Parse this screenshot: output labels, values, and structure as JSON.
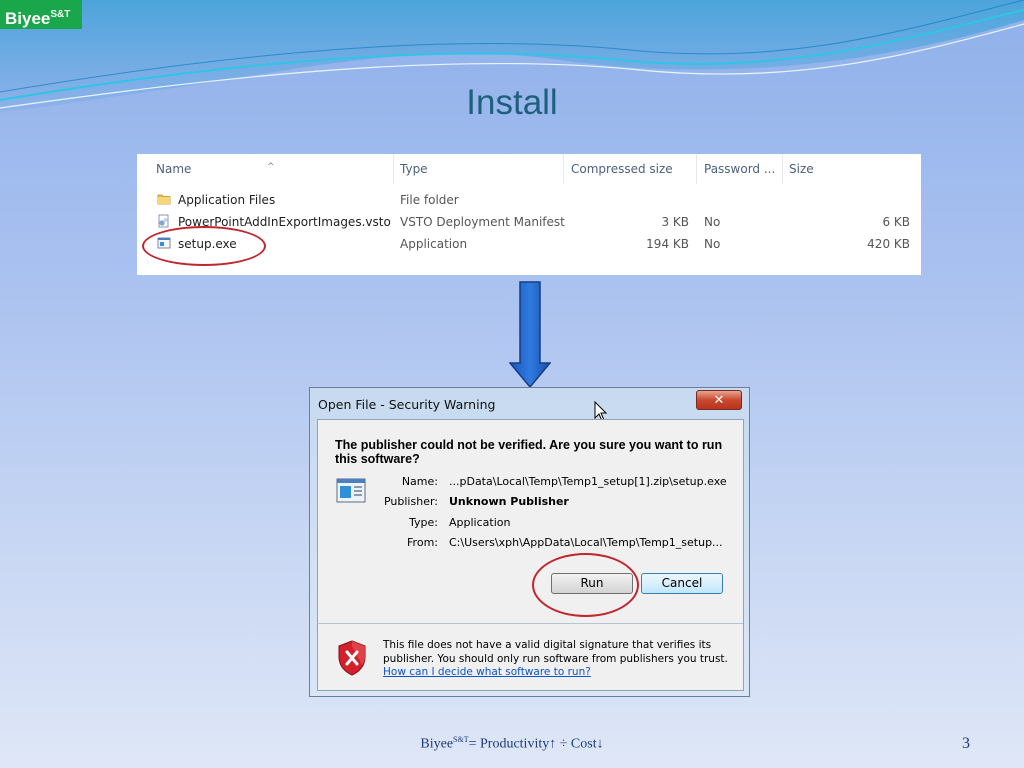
{
  "slide": {
    "logo_main": "Biyee",
    "logo_sup": "S&T",
    "title": "Install",
    "page_number": "3",
    "footer_brand": "Biyee",
    "footer_sup": "S&T",
    "footer_text": "= Productivity↑ ÷ Cost↓"
  },
  "file_list": {
    "columns": [
      "Name",
      "Type",
      "Compressed size",
      "Password ...",
      "Size"
    ],
    "rows": [
      {
        "name": "Application Files",
        "type": "File folder",
        "compressed": "",
        "password": "",
        "size": "",
        "icon": "folder-icon"
      },
      {
        "name": "PowerPointAddInExportImages.vsto",
        "type": "VSTO Deployment Manifest",
        "compressed": "3 KB",
        "password": "No",
        "size": "6 KB",
        "icon": "manifest-file-icon"
      },
      {
        "name": "setup.exe",
        "type": "Application",
        "compressed": "194 KB",
        "password": "No",
        "size": "420 KB",
        "icon": "application-icon"
      }
    ]
  },
  "dialog": {
    "title": "Open File - Security Warning",
    "close_label": "✕",
    "question": "The publisher could not be verified.  Are you sure you want to run this software?",
    "fields": [
      {
        "label": "Name:",
        "value": "...pData\\Local\\Temp\\Temp1_setup[1].zip\\setup.exe",
        "bold": false
      },
      {
        "label": "Publisher:",
        "value": "Unknown Publisher",
        "bold": true
      },
      {
        "label": "Type:",
        "value": "Application",
        "bold": false
      },
      {
        "label": "From:",
        "value": "C:\\Users\\xph\\AppData\\Local\\Temp\\Temp1_setup...",
        "bold": false
      }
    ],
    "run_label": "Run",
    "cancel_label": "Cancel",
    "warning_text": "This file does not have a valid digital signature that verifies its publisher.  You should only run software from publishers you trust.",
    "help_link": "How can I decide what software to run?"
  }
}
